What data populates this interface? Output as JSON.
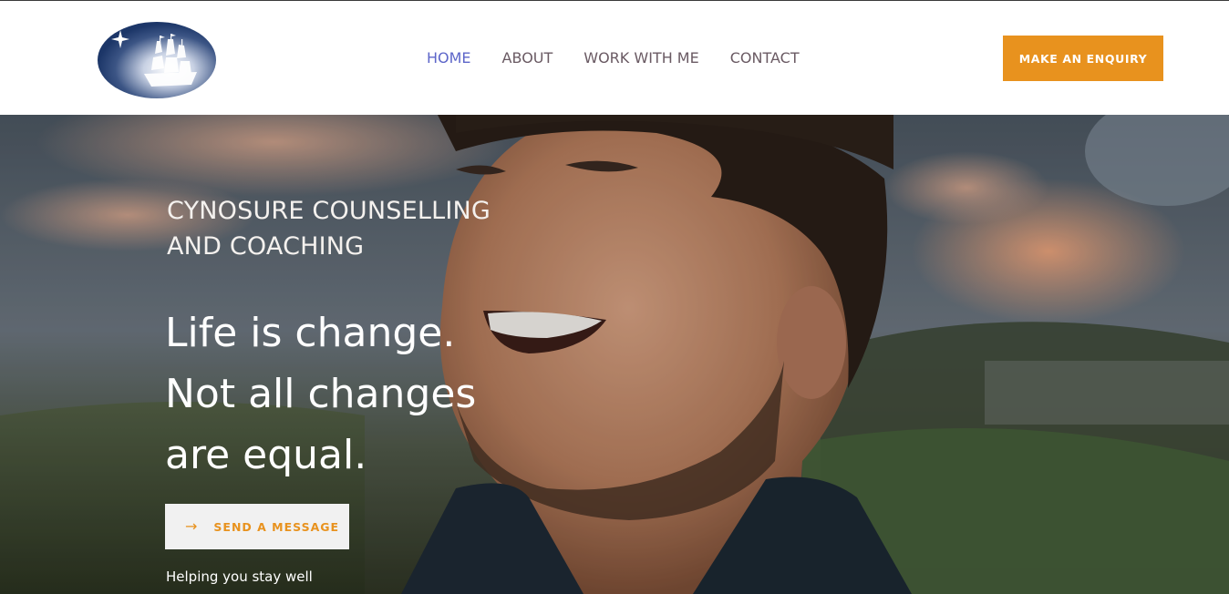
{
  "header": {
    "logo_alt": "Cynosure ship and star logo",
    "nav": [
      {
        "label": "HOME",
        "active": true
      },
      {
        "label": "ABOUT",
        "active": false
      },
      {
        "label": "WORK WITH ME",
        "active": false
      },
      {
        "label": "CONTACT",
        "active": false
      }
    ],
    "cta_label": "MAKE AN ENQUIRY"
  },
  "hero": {
    "brand_line1": "CYNOSURE COUNSELLING",
    "brand_line2": "AND COACHING",
    "headline": [
      "Life is change.",
      "Not all changes",
      "are equal."
    ],
    "send_button_label": "SEND A MESSAGE",
    "send_button_icon": "arrow-right-icon",
    "tagline": "Helping you stay well",
    "image_description_icon": "smiling-man-photo"
  },
  "colors": {
    "accent": "#e8921e",
    "nav_active": "#5d66c9",
    "nav_text": "#6a5a63",
    "logo_blue": "#1f3a6e"
  }
}
